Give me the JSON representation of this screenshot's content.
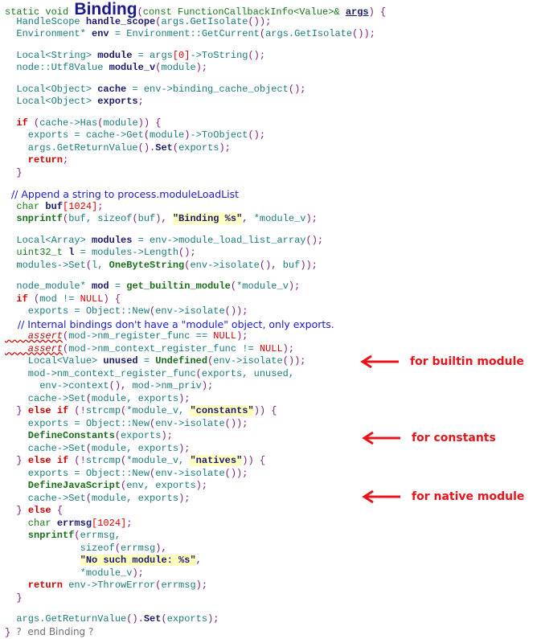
{
  "code": {
    "function_name": "Binding",
    "lines": [
      [
        [
          "kw",
          "static void "
        ],
        [
          "big",
          "Binding"
        ],
        [
          "punc",
          "("
        ],
        [
          "kw",
          "const FunctionCallbackInfo<Value>& "
        ],
        [
          "ul",
          "args"
        ],
        [
          "punc",
          ") {"
        ]
      ],
      [
        [
          "id",
          "  HandleScope "
        ],
        [
          "bold",
          "handle_scope"
        ],
        [
          "punc",
          "("
        ],
        [
          "id",
          "args.GetIsolate"
        ],
        [
          "punc",
          "());"
        ]
      ],
      [
        [
          "id",
          "  Environment* "
        ],
        [
          "bold",
          "env"
        ],
        [
          "id",
          " = Environment::GetCurrent"
        ],
        [
          "punc",
          "("
        ],
        [
          "id",
          "args.GetIsolate"
        ],
        [
          "punc",
          "());"
        ]
      ],
      "blank",
      [
        [
          "id",
          "  Local<String> "
        ],
        [
          "bold",
          "module"
        ],
        [
          "id",
          " = args"
        ],
        [
          "num",
          "[0]"
        ],
        [
          "id",
          "->ToString"
        ],
        [
          "punc",
          "();"
        ]
      ],
      [
        [
          "id",
          "  node::Utf8Value "
        ],
        [
          "bold",
          "module_v"
        ],
        [
          "punc",
          "("
        ],
        [
          "id",
          "module"
        ],
        [
          "punc",
          ");"
        ]
      ],
      "blank",
      [
        [
          "id",
          "  Local<Object> "
        ],
        [
          "bold",
          "cache"
        ],
        [
          "id",
          " = env->binding_cache_object"
        ],
        [
          "punc",
          "();"
        ]
      ],
      [
        [
          "id",
          "  Local<Object> "
        ],
        [
          "bold",
          "exports"
        ],
        [
          "punc",
          ";"
        ]
      ],
      "blank",
      [
        [
          "red",
          "  if "
        ],
        [
          "punc",
          "("
        ],
        [
          "id",
          "cache->Has"
        ],
        [
          "punc",
          "("
        ],
        [
          "id",
          "module"
        ],
        [
          "punc",
          ")) {"
        ]
      ],
      [
        [
          "id",
          "    exports = cache->Get"
        ],
        [
          "punc",
          "("
        ],
        [
          "id",
          "module"
        ],
        [
          "punc",
          ")"
        ],
        [
          "id",
          "->ToObject"
        ],
        [
          "punc",
          "();"
        ]
      ],
      [
        [
          "id",
          "    args.GetReturnValue"
        ],
        [
          "punc",
          "()."
        ],
        [
          "bold",
          "Set"
        ],
        [
          "punc",
          "("
        ],
        [
          "id",
          "exports"
        ],
        [
          "punc",
          ");"
        ]
      ],
      [
        [
          "red",
          "    return"
        ],
        [
          "punc",
          ";"
        ]
      ],
      [
        [
          "punc",
          "  }"
        ]
      ],
      "blank",
      [
        [
          "cmt",
          "  // Append a string to process.moduleLoadList"
        ]
      ],
      [
        [
          "kw",
          "  char "
        ],
        [
          "bold",
          "buf"
        ],
        [
          "num",
          "[1024]"
        ],
        [
          "punc",
          ";"
        ]
      ],
      [
        [
          "fn",
          "  snprintf"
        ],
        [
          "punc",
          "("
        ],
        [
          "id",
          "buf, sizeof"
        ],
        [
          "punc",
          "("
        ],
        [
          "id",
          "buf"
        ],
        [
          "punc",
          "), "
        ],
        [
          "str",
          "\"Binding %s\""
        ],
        [
          "punc",
          ", "
        ],
        [
          "id",
          "*module_v"
        ],
        [
          "punc",
          ");"
        ]
      ],
      "blank",
      [
        [
          "id",
          "  Local<Array> "
        ],
        [
          "bold",
          "modules"
        ],
        [
          "id",
          " = env->module_load_list_array"
        ],
        [
          "punc",
          "();"
        ]
      ],
      [
        [
          "kw",
          "  uint32_t "
        ],
        [
          "bold",
          "l"
        ],
        [
          "id",
          " = modules->Length"
        ],
        [
          "punc",
          "();"
        ]
      ],
      [
        [
          "id",
          "  modules->Set"
        ],
        [
          "punc",
          "("
        ],
        [
          "id",
          "l, "
        ],
        [
          "fn",
          "OneByteString"
        ],
        [
          "punc",
          "("
        ],
        [
          "id",
          "env->isolate"
        ],
        [
          "punc",
          "(), "
        ],
        [
          "id",
          "buf"
        ],
        [
          "punc",
          "));"
        ]
      ],
      "blank",
      [
        [
          "id",
          "  node_module* "
        ],
        [
          "bold",
          "mod"
        ],
        [
          "id",
          " = "
        ],
        [
          "fn",
          "get_builtin_module"
        ],
        [
          "punc",
          "("
        ],
        [
          "id",
          "*module_v"
        ],
        [
          "punc",
          ");"
        ]
      ],
      [
        [
          "red",
          "  if "
        ],
        [
          "punc",
          "("
        ],
        [
          "id",
          "mod != "
        ],
        [
          "num",
          "NULL"
        ],
        [
          "punc",
          ") {"
        ]
      ],
      [
        [
          "id",
          "    exports = Object::New"
        ],
        [
          "punc",
          "("
        ],
        [
          "id",
          "env->isolate"
        ],
        [
          "punc",
          "());"
        ]
      ],
      [
        [
          "cmt",
          "    // Internal bindings don't have a \"module\" object, only exports."
        ]
      ],
      [
        [
          "warn",
          "    assert"
        ],
        [
          "punc",
          "("
        ],
        [
          "id",
          "mod->nm_register_func == "
        ],
        [
          "num",
          "NULL"
        ],
        [
          "punc",
          ");"
        ]
      ],
      [
        [
          "warn",
          "    assert"
        ],
        [
          "punc",
          "("
        ],
        [
          "id",
          "mod->nm_context_register_func != "
        ],
        [
          "num",
          "NULL"
        ],
        [
          "punc",
          ");"
        ]
      ],
      [
        [
          "id",
          "    Local<Value> "
        ],
        [
          "bold",
          "unused"
        ],
        [
          "id",
          " = "
        ],
        [
          "fn",
          "Undefined"
        ],
        [
          "punc",
          "("
        ],
        [
          "id",
          "env->isolate"
        ],
        [
          "punc",
          "());"
        ]
      ],
      [
        [
          "id",
          "    mod->nm_context_register_func"
        ],
        [
          "punc",
          "("
        ],
        [
          "id",
          "exports, unused,"
        ]
      ],
      [
        [
          "id",
          "      env->context"
        ],
        [
          "punc",
          "(), "
        ],
        [
          "id",
          "mod->nm_priv"
        ],
        [
          "punc",
          ");"
        ]
      ],
      [
        [
          "id",
          "    cache->Set"
        ],
        [
          "punc",
          "("
        ],
        [
          "id",
          "module, exports"
        ],
        [
          "punc",
          ");"
        ]
      ],
      [
        [
          "punc",
          "  } "
        ],
        [
          "red",
          "else if "
        ],
        [
          "punc",
          "(!"
        ],
        [
          "id",
          "strcmp"
        ],
        [
          "punc",
          "("
        ],
        [
          "id",
          "*module_v, "
        ],
        [
          "str",
          "\"constants\""
        ],
        [
          "punc",
          ")) {"
        ]
      ],
      [
        [
          "id",
          "    exports = Object::New"
        ],
        [
          "punc",
          "("
        ],
        [
          "id",
          "env->isolate"
        ],
        [
          "punc",
          "());"
        ]
      ],
      [
        [
          "fn",
          "    DefineConstants"
        ],
        [
          "punc",
          "("
        ],
        [
          "id",
          "exports"
        ],
        [
          "punc",
          ");"
        ]
      ],
      [
        [
          "id",
          "    cache->Set"
        ],
        [
          "punc",
          "("
        ],
        [
          "id",
          "module, exports"
        ],
        [
          "punc",
          ");"
        ]
      ],
      [
        [
          "punc",
          "  } "
        ],
        [
          "red",
          "else if "
        ],
        [
          "punc",
          "(!"
        ],
        [
          "id",
          "strcmp"
        ],
        [
          "punc",
          "("
        ],
        [
          "id",
          "*module_v, "
        ],
        [
          "str",
          "\"natives\""
        ],
        [
          "punc",
          ")) {"
        ]
      ],
      [
        [
          "id",
          "    exports = Object::New"
        ],
        [
          "punc",
          "("
        ],
        [
          "id",
          "env->isolate"
        ],
        [
          "punc",
          "());"
        ]
      ],
      [
        [
          "fn",
          "    DefineJavaScript"
        ],
        [
          "punc",
          "("
        ],
        [
          "id",
          "env, exports"
        ],
        [
          "punc",
          ");"
        ]
      ],
      [
        [
          "id",
          "    cache->Set"
        ],
        [
          "punc",
          "("
        ],
        [
          "id",
          "module, exports"
        ],
        [
          "punc",
          ");"
        ]
      ],
      [
        [
          "punc",
          "  } "
        ],
        [
          "red",
          "else "
        ],
        [
          "punc",
          "{"
        ]
      ],
      [
        [
          "kw",
          "    char "
        ],
        [
          "bold",
          "errmsg"
        ],
        [
          "num",
          "[1024]"
        ],
        [
          "punc",
          ";"
        ]
      ],
      [
        [
          "fn",
          "    snprintf"
        ],
        [
          "punc",
          "("
        ],
        [
          "id",
          "errmsg,"
        ]
      ],
      [
        [
          "id",
          "             sizeof"
        ],
        [
          "punc",
          "("
        ],
        [
          "id",
          "errmsg"
        ],
        [
          "punc",
          "),"
        ]
      ],
      [
        [
          "id",
          "             "
        ],
        [
          "str",
          "\"No such module: %s\""
        ],
        [
          "punc",
          ","
        ]
      ],
      [
        [
          "id",
          "             *module_v"
        ],
        [
          "punc",
          ");"
        ]
      ],
      [
        [
          "red",
          "    return "
        ],
        [
          "id",
          "env->ThrowError"
        ],
        [
          "punc",
          "("
        ],
        [
          "id",
          "errmsg"
        ],
        [
          "punc",
          ");"
        ]
      ],
      [
        [
          "punc",
          "  }"
        ]
      ],
      "blank",
      [
        [
          "id",
          "  args.GetReturnValue"
        ],
        [
          "punc",
          "()."
        ],
        [
          "bold",
          "Set"
        ],
        [
          "punc",
          "("
        ],
        [
          "id",
          "exports"
        ],
        [
          "punc",
          ");"
        ]
      ],
      [
        [
          "punc",
          "} "
        ],
        [
          "end",
          "?  end Binding ?"
        ]
      ]
    ]
  },
  "annotations": [
    {
      "label": "for builtin module",
      "color": "#e8141c"
    },
    {
      "label": "for constants",
      "color": "#e8141c"
    },
    {
      "label": "for native module",
      "color": "#e8141c"
    }
  ]
}
